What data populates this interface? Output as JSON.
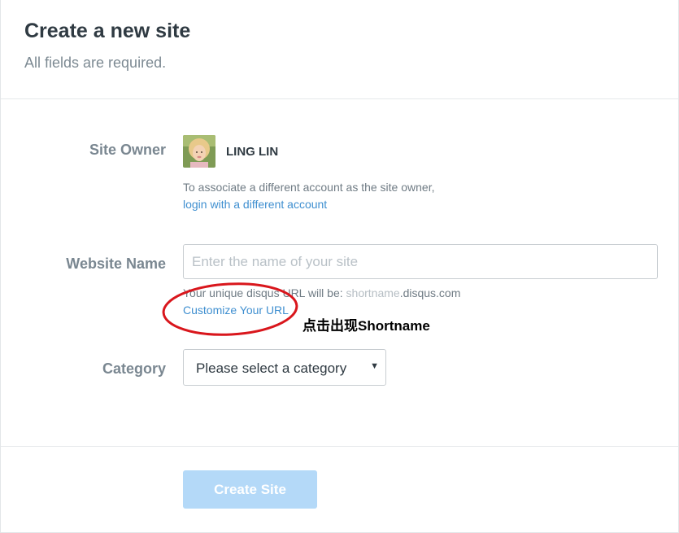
{
  "header": {
    "title": "Create a new site",
    "subtitle": "All fields are required."
  },
  "owner": {
    "label": "Site Owner",
    "name": "LING LIN",
    "helper_text": "To associate a different account as the site owner,",
    "switch_link": "login with a different account"
  },
  "website": {
    "label": "Website Name",
    "placeholder": "Enter the name of your site",
    "value": "",
    "url_prefix": "Your unique disqus URL will be: ",
    "url_shortname": "shortname",
    "url_domain": ".disqus.com",
    "customize_link": "Customize Your URL"
  },
  "annotation": {
    "text": "点击出现Shortname",
    "color": "#d9161c"
  },
  "category": {
    "label": "Category",
    "selected": "Please select a category",
    "arrow": "▼"
  },
  "actions": {
    "submit_label": "Create Site"
  },
  "colors": {
    "link": "#3f8fd0",
    "submit_disabled": "#b4d9f8"
  }
}
